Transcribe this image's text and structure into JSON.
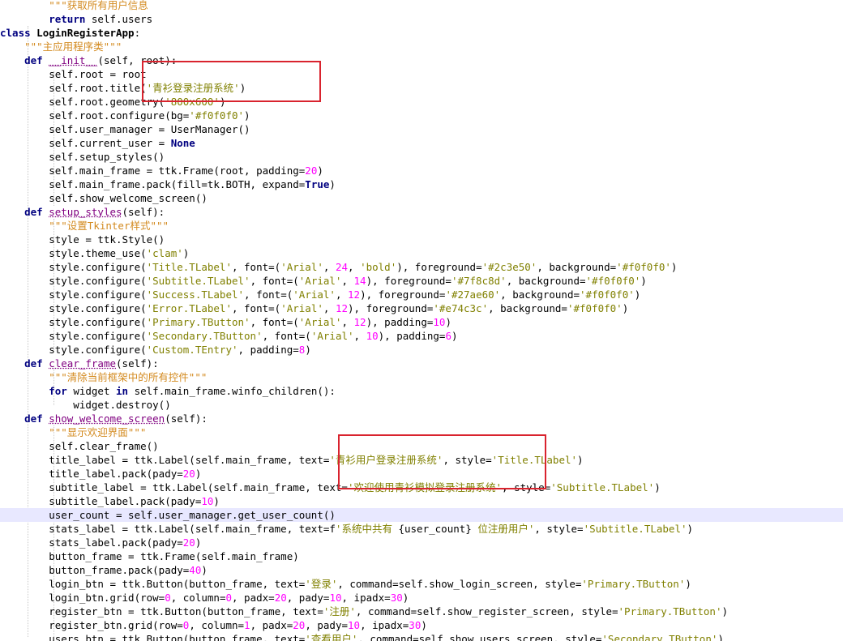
{
  "editor": {
    "colors": {
      "background": "#ffffff",
      "current_line": "#e8e8ff",
      "keyword": "#000080",
      "string": "#808000",
      "docstring": "#d38a1f",
      "number": "#ff00ff",
      "definition": "#800080",
      "highlight_box": "#d9232e"
    },
    "lines": [
      {
        "tokens": [
          {
            "t": "        ",
            "c": ""
          },
          {
            "t": "\"\"\"获取所有用户信息",
            "c": "doc"
          }
        ]
      },
      {
        "tokens": [
          {
            "t": "        ",
            "c": ""
          },
          {
            "t": "return",
            "c": "kw"
          },
          {
            "t": " self.users",
            "c": ""
          }
        ]
      },
      {
        "tokens": [
          {
            "t": "class",
            "c": "kw"
          },
          {
            "t": " ",
            "c": ""
          },
          {
            "t": "LoginRegisterApp",
            "c": "cls"
          },
          {
            "t": ":",
            "c": ""
          }
        ]
      },
      {
        "tokens": [
          {
            "t": "    ",
            "c": ""
          },
          {
            "t": "\"\"\"主应用程序类\"\"\"",
            "c": "doc"
          }
        ]
      },
      {
        "tokens": [
          {
            "t": "    ",
            "c": ""
          },
          {
            "t": "def",
            "c": "kw"
          },
          {
            "t": " ",
            "c": ""
          },
          {
            "t": "__init__",
            "c": "def"
          },
          {
            "t": "(self, root):",
            "c": ""
          }
        ]
      },
      {
        "tokens": [
          {
            "t": "        self.root = root",
            "c": ""
          }
        ]
      },
      {
        "tokens": [
          {
            "t": "        self.root.title(",
            "c": ""
          },
          {
            "t": "'青衫登录注册系统'",
            "c": "str"
          },
          {
            "t": ")",
            "c": ""
          }
        ]
      },
      {
        "tokens": [
          {
            "t": "        self.root.geometry(",
            "c": ""
          },
          {
            "t": "'800x600'",
            "c": "str"
          },
          {
            "t": ")",
            "c": ""
          }
        ]
      },
      {
        "tokens": [
          {
            "t": "        self.root.configure(bg=",
            "c": ""
          },
          {
            "t": "'#f0f0f0'",
            "c": "str"
          },
          {
            "t": ")",
            "c": ""
          }
        ]
      },
      {
        "tokens": [
          {
            "t": "        self.user_manager = UserManager()",
            "c": ""
          }
        ]
      },
      {
        "tokens": [
          {
            "t": "        self.current_user = ",
            "c": ""
          },
          {
            "t": "None",
            "c": "kw"
          }
        ]
      },
      {
        "tokens": [
          {
            "t": "        self.setup_styles()",
            "c": ""
          }
        ]
      },
      {
        "tokens": [
          {
            "t": "        self.main_frame = ttk.Frame(root, padding=",
            "c": ""
          },
          {
            "t": "20",
            "c": "num"
          },
          {
            "t": ")",
            "c": ""
          }
        ]
      },
      {
        "tokens": [
          {
            "t": "        self.main_frame.pack(fill=tk.BOTH, expand=",
            "c": ""
          },
          {
            "t": "True",
            "c": "kw"
          },
          {
            "t": ")",
            "c": ""
          }
        ]
      },
      {
        "tokens": [
          {
            "t": "        self.show_welcome_screen()",
            "c": ""
          }
        ]
      },
      {
        "tokens": [
          {
            "t": "    ",
            "c": ""
          },
          {
            "t": "def",
            "c": "kw"
          },
          {
            "t": " ",
            "c": ""
          },
          {
            "t": "setup_styles",
            "c": "def"
          },
          {
            "t": "(self):",
            "c": ""
          }
        ]
      },
      {
        "tokens": [
          {
            "t": "        ",
            "c": ""
          },
          {
            "t": "\"\"\"设置Tkinter样式\"\"\"",
            "c": "doc"
          }
        ]
      },
      {
        "tokens": [
          {
            "t": "        style = ttk.Style()",
            "c": ""
          }
        ]
      },
      {
        "tokens": [
          {
            "t": "        style.theme_use(",
            "c": ""
          },
          {
            "t": "'clam'",
            "c": "str"
          },
          {
            "t": ")",
            "c": ""
          }
        ]
      },
      {
        "tokens": [
          {
            "t": "        style.configure(",
            "c": ""
          },
          {
            "t": "'Title.TLabel'",
            "c": "str"
          },
          {
            "t": ", font=(",
            "c": ""
          },
          {
            "t": "'Arial'",
            "c": "str"
          },
          {
            "t": ", ",
            "c": ""
          },
          {
            "t": "24",
            "c": "num"
          },
          {
            "t": ", ",
            "c": ""
          },
          {
            "t": "'bold'",
            "c": "str"
          },
          {
            "t": "), foreground=",
            "c": ""
          },
          {
            "t": "'#2c3e50'",
            "c": "str"
          },
          {
            "t": ", background=",
            "c": ""
          },
          {
            "t": "'#f0f0f0'",
            "c": "str"
          },
          {
            "t": ")",
            "c": ""
          }
        ]
      },
      {
        "tokens": [
          {
            "t": "        style.configure(",
            "c": ""
          },
          {
            "t": "'Subtitle.TLabel'",
            "c": "str"
          },
          {
            "t": ", font=(",
            "c": ""
          },
          {
            "t": "'Arial'",
            "c": "str"
          },
          {
            "t": ", ",
            "c": ""
          },
          {
            "t": "14",
            "c": "num"
          },
          {
            "t": "), foreground=",
            "c": ""
          },
          {
            "t": "'#7f8c8d'",
            "c": "str"
          },
          {
            "t": ", background=",
            "c": ""
          },
          {
            "t": "'#f0f0f0'",
            "c": "str"
          },
          {
            "t": ")",
            "c": ""
          }
        ]
      },
      {
        "tokens": [
          {
            "t": "        style.configure(",
            "c": ""
          },
          {
            "t": "'Success.TLabel'",
            "c": "str"
          },
          {
            "t": ", font=(",
            "c": ""
          },
          {
            "t": "'Arial'",
            "c": "str"
          },
          {
            "t": ", ",
            "c": ""
          },
          {
            "t": "12",
            "c": "num"
          },
          {
            "t": "), foreground=",
            "c": ""
          },
          {
            "t": "'#27ae60'",
            "c": "str"
          },
          {
            "t": ", background=",
            "c": ""
          },
          {
            "t": "'#f0f0f0'",
            "c": "str"
          },
          {
            "t": ")",
            "c": ""
          }
        ]
      },
      {
        "tokens": [
          {
            "t": "        style.configure(",
            "c": ""
          },
          {
            "t": "'Error.TLabel'",
            "c": "str"
          },
          {
            "t": ", font=(",
            "c": ""
          },
          {
            "t": "'Arial'",
            "c": "str"
          },
          {
            "t": ", ",
            "c": ""
          },
          {
            "t": "12",
            "c": "num"
          },
          {
            "t": "), foreground=",
            "c": ""
          },
          {
            "t": "'#e74c3c'",
            "c": "str"
          },
          {
            "t": ", background=",
            "c": ""
          },
          {
            "t": "'#f0f0f0'",
            "c": "str"
          },
          {
            "t": ")",
            "c": ""
          }
        ]
      },
      {
        "tokens": [
          {
            "t": "        style.configure(",
            "c": ""
          },
          {
            "t": "'Primary.TButton'",
            "c": "str"
          },
          {
            "t": ", font=(",
            "c": ""
          },
          {
            "t": "'Arial'",
            "c": "str"
          },
          {
            "t": ", ",
            "c": ""
          },
          {
            "t": "12",
            "c": "num"
          },
          {
            "t": "), padding=",
            "c": ""
          },
          {
            "t": "10",
            "c": "num"
          },
          {
            "t": ")",
            "c": ""
          }
        ]
      },
      {
        "tokens": [
          {
            "t": "        style.configure(",
            "c": ""
          },
          {
            "t": "'Secondary.TButton'",
            "c": "str"
          },
          {
            "t": ", font=(",
            "c": ""
          },
          {
            "t": "'Arial'",
            "c": "str"
          },
          {
            "t": ", ",
            "c": ""
          },
          {
            "t": "10",
            "c": "num"
          },
          {
            "t": "), padding=",
            "c": ""
          },
          {
            "t": "6",
            "c": "num"
          },
          {
            "t": ")",
            "c": ""
          }
        ]
      },
      {
        "tokens": [
          {
            "t": "        style.configure(",
            "c": ""
          },
          {
            "t": "'Custom.TEntry'",
            "c": "str"
          },
          {
            "t": ", padding=",
            "c": ""
          },
          {
            "t": "8",
            "c": "num"
          },
          {
            "t": ")",
            "c": ""
          }
        ]
      },
      {
        "tokens": [
          {
            "t": "    ",
            "c": ""
          },
          {
            "t": "def",
            "c": "kw"
          },
          {
            "t": " ",
            "c": ""
          },
          {
            "t": "clear_frame",
            "c": "def"
          },
          {
            "t": "(self):",
            "c": ""
          }
        ]
      },
      {
        "tokens": [
          {
            "t": "        ",
            "c": ""
          },
          {
            "t": "\"\"\"清除当前框架中的所有控件\"\"\"",
            "c": "doc"
          }
        ]
      },
      {
        "tokens": [
          {
            "t": "        ",
            "c": ""
          },
          {
            "t": "for",
            "c": "kw"
          },
          {
            "t": " widget ",
            "c": ""
          },
          {
            "t": "in",
            "c": "kw"
          },
          {
            "t": " self.main_frame.winfo_children():",
            "c": ""
          }
        ]
      },
      {
        "tokens": [
          {
            "t": "            widget.destroy()",
            "c": ""
          }
        ]
      },
      {
        "tokens": [
          {
            "t": "    ",
            "c": ""
          },
          {
            "t": "def",
            "c": "kw"
          },
          {
            "t": " ",
            "c": ""
          },
          {
            "t": "show_welcome_screen",
            "c": "def"
          },
          {
            "t": "(self):",
            "c": ""
          }
        ]
      },
      {
        "tokens": [
          {
            "t": "        ",
            "c": ""
          },
          {
            "t": "\"\"\"显示欢迎界面\"\"\"",
            "c": "doc"
          }
        ]
      },
      {
        "tokens": [
          {
            "t": "        self.clear_frame()",
            "c": ""
          }
        ]
      },
      {
        "tokens": [
          {
            "t": "        title_label = ttk.Label(self.main_frame, text=",
            "c": ""
          },
          {
            "t": "'青衫用户登录注册系统'",
            "c": "str"
          },
          {
            "t": ", style=",
            "c": ""
          },
          {
            "t": "'Title.TLabel'",
            "c": "str"
          },
          {
            "t": ")",
            "c": ""
          }
        ]
      },
      {
        "tokens": [
          {
            "t": "        title_label.pack(pady=",
            "c": ""
          },
          {
            "t": "20",
            "c": "num"
          },
          {
            "t": ")",
            "c": ""
          }
        ]
      },
      {
        "tokens": [
          {
            "t": "        subtitle_label = ttk.Label(self.main_frame, text=",
            "c": ""
          },
          {
            "t": "'欢迎使用青衫模拟登录注册系统'",
            "c": "str"
          },
          {
            "t": ", style=",
            "c": ""
          },
          {
            "t": "'Subtitle.TLabel'",
            "c": "str"
          },
          {
            "t": ")",
            "c": ""
          }
        ]
      },
      {
        "tokens": [
          {
            "t": "        subtitle_label.pack(pady=",
            "c": ""
          },
          {
            "t": "10",
            "c": "num"
          },
          {
            "t": ")",
            "c": ""
          }
        ]
      },
      {
        "tokens": [
          {
            "t": "        user_count = self.user_manager.get_user_count()",
            "c": ""
          }
        ],
        "current": true
      },
      {
        "tokens": [
          {
            "t": "        stats_label = ttk.Label(self.main_frame, text=f",
            "c": ""
          },
          {
            "t": "'系统中共有 ",
            "c": "str"
          },
          {
            "t": "{user_count}",
            "c": "ph"
          },
          {
            "t": " 位注册用户'",
            "c": "str"
          },
          {
            "t": ", style=",
            "c": ""
          },
          {
            "t": "'Subtitle.TLabel'",
            "c": "str"
          },
          {
            "t": ")",
            "c": ""
          }
        ]
      },
      {
        "tokens": [
          {
            "t": "        stats_label.pack(pady=",
            "c": ""
          },
          {
            "t": "20",
            "c": "num"
          },
          {
            "t": ")",
            "c": ""
          }
        ]
      },
      {
        "tokens": [
          {
            "t": "        button_frame = ttk.Frame(self.main_frame)",
            "c": ""
          }
        ]
      },
      {
        "tokens": [
          {
            "t": "        button_frame.pack(pady=",
            "c": ""
          },
          {
            "t": "40",
            "c": "num"
          },
          {
            "t": ")",
            "c": ""
          }
        ]
      },
      {
        "tokens": [
          {
            "t": "        login_btn = ttk.Button(button_frame, text=",
            "c": ""
          },
          {
            "t": "'登录'",
            "c": "str"
          },
          {
            "t": ", command=self.show_login_screen, style=",
            "c": ""
          },
          {
            "t": "'Primary.TButton'",
            "c": "str"
          },
          {
            "t": ")",
            "c": ""
          }
        ]
      },
      {
        "tokens": [
          {
            "t": "        login_btn.grid(row=",
            "c": ""
          },
          {
            "t": "0",
            "c": "num"
          },
          {
            "t": ", column=",
            "c": ""
          },
          {
            "t": "0",
            "c": "num"
          },
          {
            "t": ", padx=",
            "c": ""
          },
          {
            "t": "20",
            "c": "num"
          },
          {
            "t": ", pady=",
            "c": ""
          },
          {
            "t": "10",
            "c": "num"
          },
          {
            "t": ", ipadx=",
            "c": ""
          },
          {
            "t": "30",
            "c": "num"
          },
          {
            "t": ")",
            "c": ""
          }
        ]
      },
      {
        "tokens": [
          {
            "t": "        register_btn = ttk.Button(button_frame, text=",
            "c": ""
          },
          {
            "t": "'注册'",
            "c": "str"
          },
          {
            "t": ", command=self.show_register_screen, style=",
            "c": ""
          },
          {
            "t": "'Primary.TButton'",
            "c": "str"
          },
          {
            "t": ")",
            "c": ""
          }
        ]
      },
      {
        "tokens": [
          {
            "t": "        register_btn.grid(row=",
            "c": ""
          },
          {
            "t": "0",
            "c": "num"
          },
          {
            "t": ", column=",
            "c": ""
          },
          {
            "t": "1",
            "c": "num"
          },
          {
            "t": ", padx=",
            "c": ""
          },
          {
            "t": "20",
            "c": "num"
          },
          {
            "t": ", pady=",
            "c": ""
          },
          {
            "t": "10",
            "c": "num"
          },
          {
            "t": ", ipadx=",
            "c": ""
          },
          {
            "t": "30",
            "c": "num"
          },
          {
            "t": ")",
            "c": ""
          }
        ]
      },
      {
        "tokens": [
          {
            "t": "        users_btn = ttk.Button(button_frame, text=",
            "c": ""
          },
          {
            "t": "'查看用户'",
            "c": "str"
          },
          {
            "t": ", command=self.show_users_screen, style=",
            "c": ""
          },
          {
            "t": "'Secondary.TButton'",
            "c": "str"
          },
          {
            "t": ")",
            "c": ""
          }
        ]
      }
    ]
  }
}
